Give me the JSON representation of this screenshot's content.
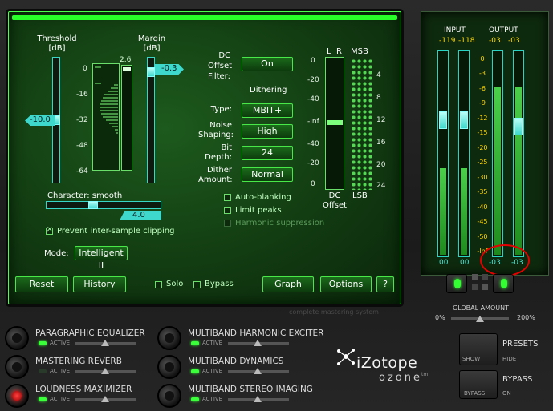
{
  "dynamics": {
    "threshold_label": "Threshold",
    "threshold_unit": "[dB]",
    "margin_label": "Margin",
    "margin_unit": "[dB]",
    "threshold_value": "-10.0",
    "margin_value": "-0.3",
    "gr_value": "2.6",
    "scale": [
      "0",
      "-16",
      "-32",
      "-48",
      "-64"
    ],
    "character_label": "Character: smooth",
    "character_value": "4.0",
    "prevent_clip_label": "Prevent inter-sample clipping",
    "prevent_clip_checked": true,
    "mode_label": "Mode:",
    "mode_value": "Intelligent II"
  },
  "dither": {
    "dc_offset_filter_label": "DC Offset Filter:",
    "dc_offset_filter_value": "On",
    "dithering_heading": "Dithering",
    "type_label": "Type:",
    "type_value": "MBIT+",
    "noise_label": "Noise Shaping:",
    "noise_value": "High",
    "bit_label": "Bit Depth:",
    "bit_value": "24",
    "amount_label": "Dither Amount:",
    "amount_value": "Normal",
    "auto_blanking": "Auto-blanking",
    "limit_peaks": "Limit peaks",
    "harmonic": "Harmonic suppression"
  },
  "dc_meter": {
    "l": "L",
    "r": "R",
    "scale": [
      "0",
      "-20",
      "-40",
      "-Inf",
      "-40",
      "-20",
      "0"
    ],
    "caption": "DC Offset"
  },
  "bit_meter": {
    "msb": "MSB",
    "lsb": "LSB",
    "scale": [
      "4",
      "8",
      "12",
      "16",
      "20",
      "24"
    ]
  },
  "bottom_bar": {
    "reset": "Reset",
    "history": "History",
    "solo": "Solo",
    "bypass": "Bypass",
    "graph": "Graph",
    "options": "Options",
    "help": "?",
    "tagline": "complete mastering system"
  },
  "meters": {
    "input_label": "INPUT",
    "output_label": "OUTPUT",
    "input_peaks": [
      "-119",
      "-118"
    ],
    "output_peaks": [
      "-03",
      "-03"
    ],
    "scale": [
      "0",
      "-3",
      "-6",
      "-9",
      "-12",
      "-15",
      "-20",
      "-25",
      "-30",
      "-35",
      "-40",
      "-45",
      "-50",
      "-Inf"
    ],
    "input_values": [
      "00",
      "00"
    ],
    "output_values": [
      "-03",
      "-03"
    ],
    "input_level_pct": 42,
    "output_level_pct": 82
  },
  "global": {
    "label": "GLOBAL AMOUNT",
    "min": "0%",
    "max": "200%"
  },
  "modules": [
    {
      "name": "PARAGRAPHIC EQUALIZER",
      "active": "ACTIVE",
      "on": true
    },
    {
      "name": "MASTERING REVERB",
      "active": "ACTIVE",
      "on": false
    },
    {
      "name": "LOUDNESS MAXIMIZER",
      "active": "ACTIVE",
      "on": true
    },
    {
      "name": "MULTIBAND HARMONIC EXCITER",
      "active": "ACTIVE",
      "on": true
    },
    {
      "name": "MULTIBAND DYNAMICS",
      "active": "ACTIVE",
      "on": true
    },
    {
      "name": "MULTIBAND STEREO IMAGING",
      "active": "ACTIVE",
      "on": true
    }
  ],
  "brand": {
    "name": "iZotope",
    "product": "ozone",
    "tm": "tm"
  },
  "presets": {
    "label": "PRESETS",
    "show": "SHOW",
    "hide": "HIDE"
  },
  "bypass_panel": {
    "label": "BYPASS",
    "bypass": "BYPASS",
    "on": "ON"
  },
  "colors": {
    "screen_green": "#28ff28",
    "meter_cyan": "#2ad4c4",
    "peak_yellow": "#ffd600",
    "annotation_red": "#e40000"
  }
}
